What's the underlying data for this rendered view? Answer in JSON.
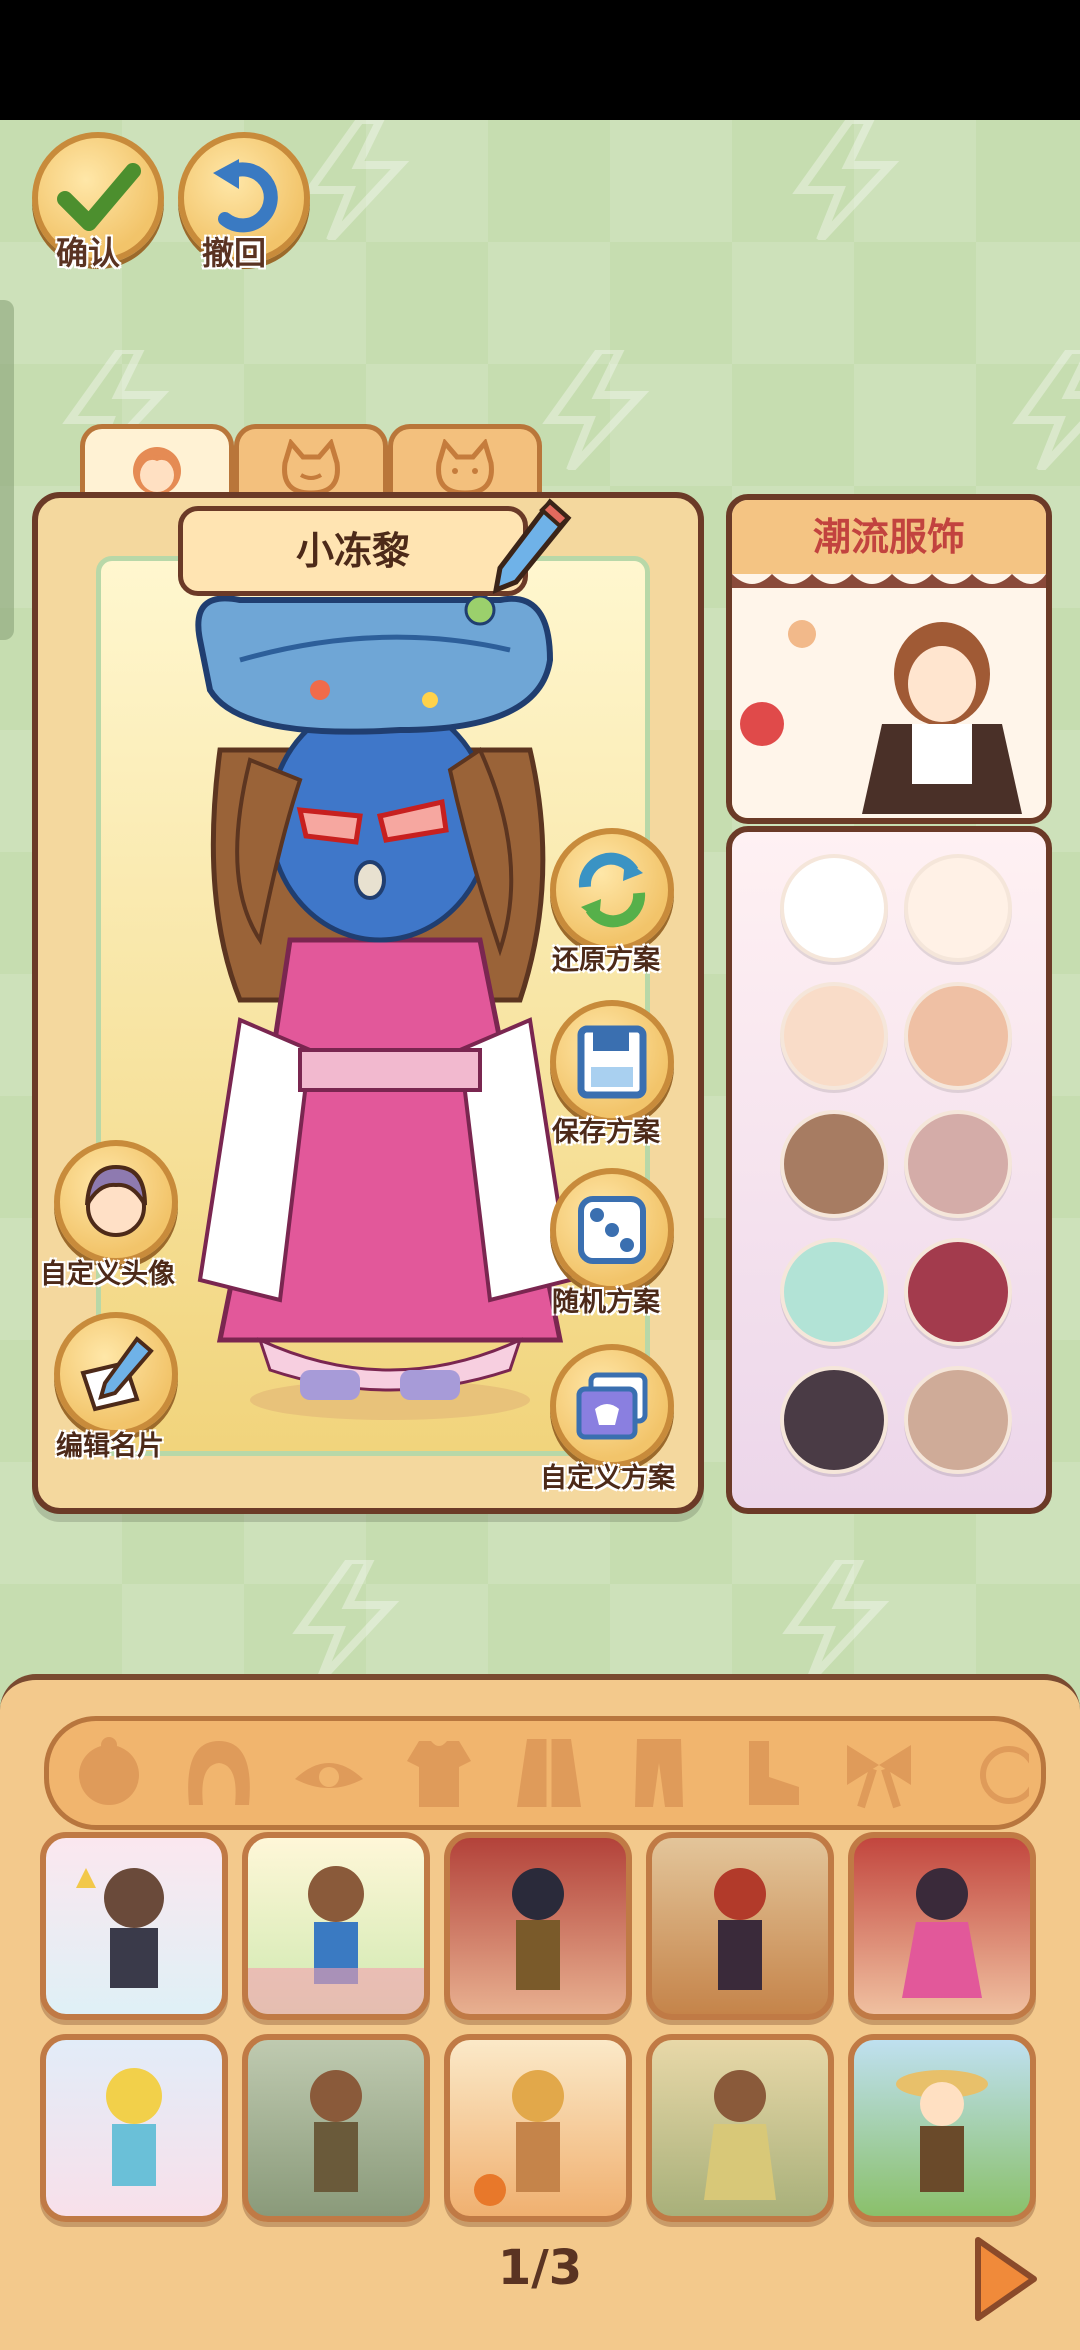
{
  "toolbar": {
    "confirm_label": "确认",
    "undo_label": "撤回"
  },
  "character": {
    "name": "小冻黎"
  },
  "actions": {
    "restore_label": "还原方案",
    "save_label": "保存方案",
    "random_label": "随机方案",
    "custom_plan_label": "自定义方案",
    "custom_avatar_label": "自定义头像",
    "edit_card_label": "编辑名片"
  },
  "fashion": {
    "title": "潮流服饰"
  },
  "skin_colors": [
    "#ffffff",
    "#fff1e6",
    "#f9dcc8",
    "#efc0a4",
    "#a77c62",
    "#d4aca8",
    "#b2e3d6",
    "#a33b4d",
    "#4a3b45",
    "#cfab98"
  ],
  "category_icons": [
    "face-icon",
    "hair-icon",
    "eye-icon",
    "top-icon",
    "coat-icon",
    "pants-icon",
    "shoes-icon",
    "bow-accessory-icon",
    "more-icon"
  ],
  "pagination": {
    "page": "1/3"
  }
}
